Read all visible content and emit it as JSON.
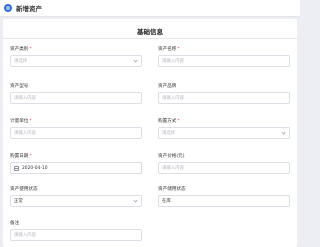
{
  "header": {
    "title": "新增资产",
    "logo_icon": "app-logo-icon"
  },
  "form": {
    "section_title": "基础信息",
    "fields": {
      "asset_category": {
        "label": "资产类别",
        "required": true,
        "placeholder": "请选择",
        "type": "select"
      },
      "asset_name": {
        "label": "资产名称",
        "required": true,
        "placeholder": "请输入内容",
        "type": "text"
      },
      "asset_model": {
        "label": "资产型号",
        "required": false,
        "placeholder": "请输入内容",
        "type": "text"
      },
      "asset_brand": {
        "label": "资产品牌",
        "required": false,
        "placeholder": "请输入内容",
        "type": "text"
      },
      "unit": {
        "label": "计量单位",
        "required": true,
        "placeholder": "请输入内容",
        "type": "text"
      },
      "purchase_method": {
        "label": "购置方式",
        "required": true,
        "placeholder": "请选择",
        "type": "select"
      },
      "purchase_date": {
        "label": "购置日期",
        "required": true,
        "value": "2020-04-10",
        "type": "date"
      },
      "asset_price": {
        "label": "资产价格(元)",
        "required": false,
        "placeholder": "请输入内容",
        "type": "text"
      },
      "usage_status": {
        "label": "资产使用状态",
        "required": false,
        "value": "正常",
        "type": "select"
      },
      "storage_status": {
        "label": "资产储用状态",
        "required": false,
        "value": "在库",
        "type": "text"
      },
      "remarks": {
        "label": "备注",
        "required": false,
        "placeholder": "请输入内容",
        "type": "text"
      }
    }
  },
  "colors": {
    "required_star": "#e0463c",
    "background": "#eceef3",
    "border": "#dcdfe6",
    "placeholder": "#b5b8bf",
    "logo": "#2f6fd6"
  }
}
